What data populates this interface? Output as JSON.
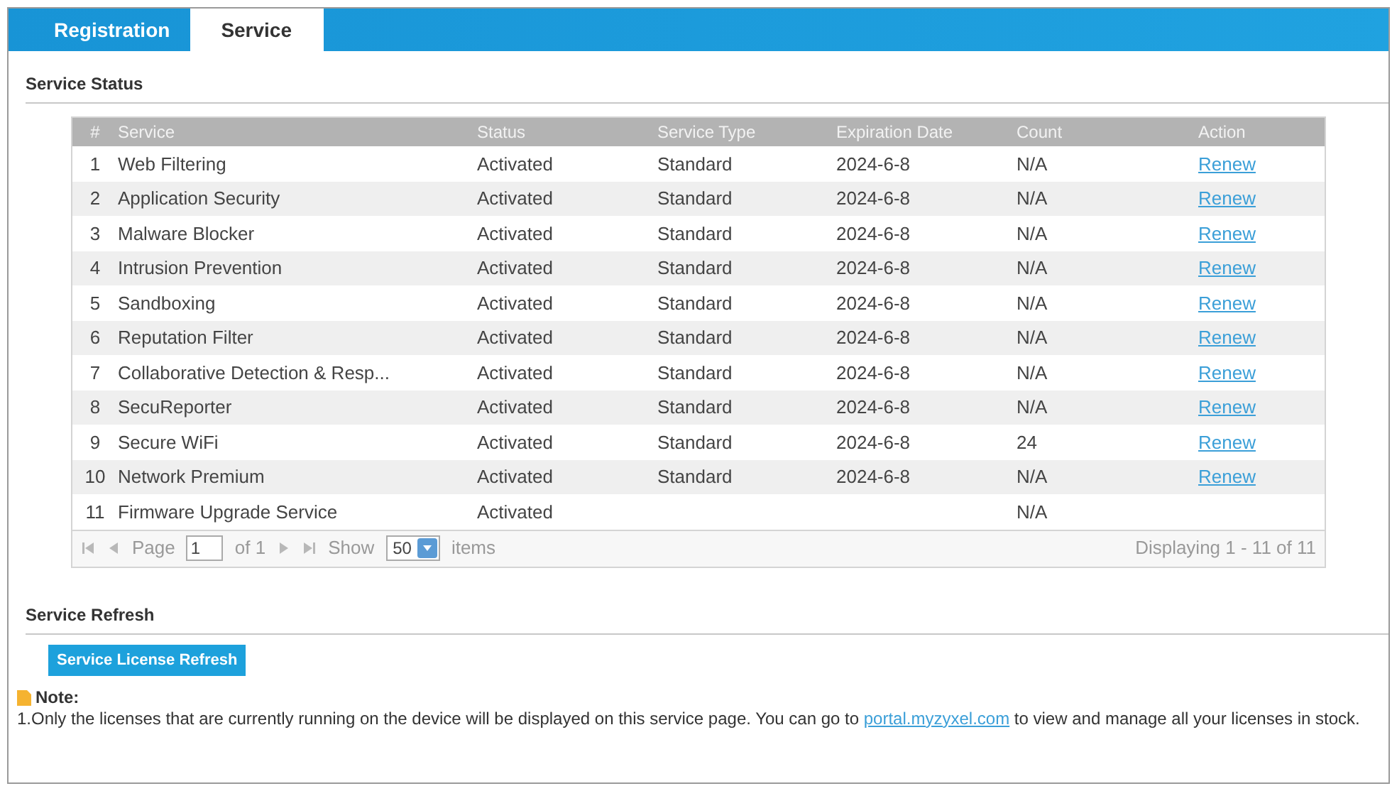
{
  "tabs": [
    {
      "label": "Registration",
      "selected": false
    },
    {
      "label": "Service",
      "selected": true
    }
  ],
  "service_status": {
    "title": "Service Status",
    "columns": [
      "#",
      "Service",
      "Status",
      "Service Type",
      "Expiration Date",
      "Count",
      "Action"
    ],
    "rows": [
      {
        "number": "1",
        "service": "Web Filtering",
        "status": "Activated",
        "service_type": "Standard",
        "expiration_date": "2024-6-8",
        "count": "N/A",
        "action": "Renew"
      },
      {
        "number": "2",
        "service": "Application Security",
        "status": "Activated",
        "service_type": "Standard",
        "expiration_date": "2024-6-8",
        "count": "N/A",
        "action": "Renew"
      },
      {
        "number": "3",
        "service": "Malware Blocker",
        "status": "Activated",
        "service_type": "Standard",
        "expiration_date": "2024-6-8",
        "count": "N/A",
        "action": "Renew"
      },
      {
        "number": "4",
        "service": "Intrusion Prevention",
        "status": "Activated",
        "service_type": "Standard",
        "expiration_date": "2024-6-8",
        "count": "N/A",
        "action": "Renew"
      },
      {
        "number": "5",
        "service": "Sandboxing",
        "status": "Activated",
        "service_type": "Standard",
        "expiration_date": "2024-6-8",
        "count": "N/A",
        "action": "Renew"
      },
      {
        "number": "6",
        "service": "Reputation Filter",
        "status": "Activated",
        "service_type": "Standard",
        "expiration_date": "2024-6-8",
        "count": "N/A",
        "action": "Renew"
      },
      {
        "number": "7",
        "service": "Collaborative Detection & Resp...",
        "status": "Activated",
        "service_type": "Standard",
        "expiration_date": "2024-6-8",
        "count": "N/A",
        "action": "Renew"
      },
      {
        "number": "8",
        "service": "SecuReporter",
        "status": "Activated",
        "service_type": "Standard",
        "expiration_date": "2024-6-8",
        "count": "N/A",
        "action": "Renew"
      },
      {
        "number": "9",
        "service": "Secure WiFi",
        "status": "Activated",
        "service_type": "Standard",
        "expiration_date": "2024-6-8",
        "count": "24",
        "action": "Renew"
      },
      {
        "number": "10",
        "service": "Network Premium",
        "status": "Activated",
        "service_type": "Standard",
        "expiration_date": "2024-6-8",
        "count": "N/A",
        "action": "Renew"
      },
      {
        "number": "11",
        "service": "Firmware Upgrade Service",
        "status": "Activated",
        "count": "N/A"
      }
    ],
    "pager": {
      "page_label": "Page",
      "page": "1",
      "of_label": "of 1",
      "show_label": "Show",
      "page_size": "50",
      "items_label": "items",
      "displaying": "Displaying 1 - 11 of 11"
    }
  },
  "service_refresh": {
    "title": "Service Refresh",
    "button": "Service License Refresh",
    "note_title": "Note:",
    "note_text": "1.Only the licenses that are currently running on the device will be displayed on this service page. You can go to",
    "note_link": "portal.myzyxel.com",
    "note_text_after": "to view and manage all your licenses in stock."
  }
}
